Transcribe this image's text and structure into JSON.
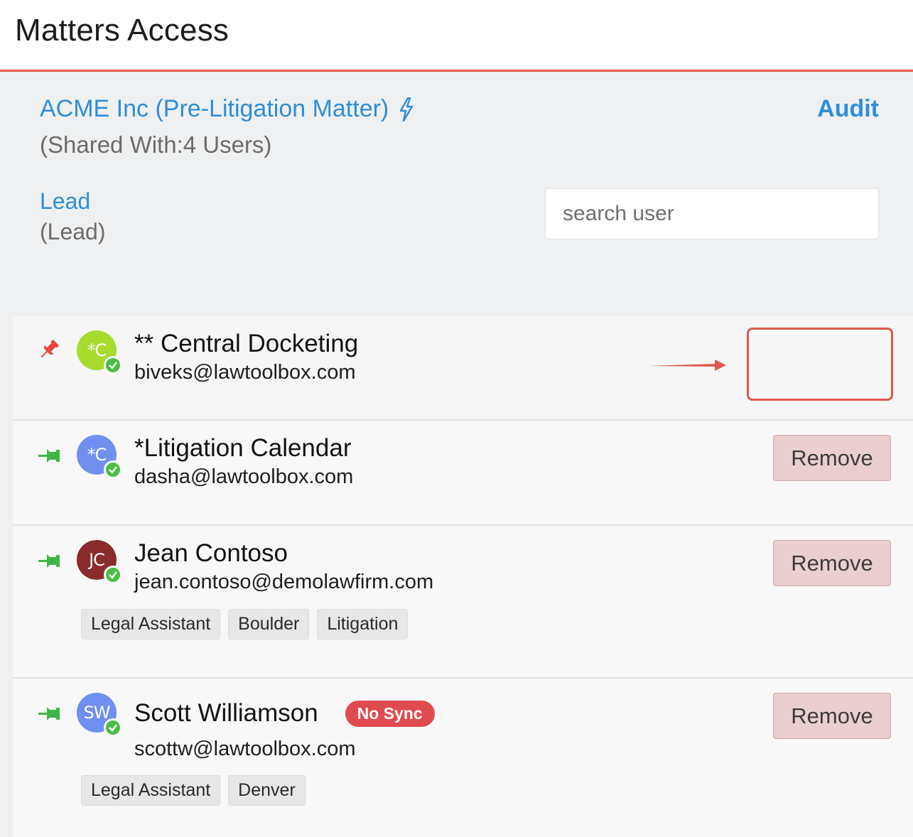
{
  "header": {
    "title": "Matters Access"
  },
  "matter": {
    "title": "ACME Inc (Pre-Litigation Matter)",
    "shared_with": "(Shared With:4 Users)",
    "audit_label": "Audit",
    "lead_label": "Lead",
    "lead_value": "(Lead)"
  },
  "search": {
    "placeholder": "search user",
    "value": ""
  },
  "users": [
    {
      "name": "** Central Docketing",
      "email": "biveks@lawtoolbox.com",
      "initials": "*C",
      "avatar_color": "#a6dc2e",
      "pin_color": "#e8473d",
      "pinned": true,
      "remove_label": "",
      "tags": []
    },
    {
      "name": "*Litigation Calendar",
      "email": "dasha@lawtoolbox.com",
      "initials": "*C",
      "avatar_color": "#6f8ff1",
      "pin_color": "#3fb549",
      "pinned": false,
      "remove_label": "Remove",
      "tags": []
    },
    {
      "name": "Jean Contoso",
      "email": "jean.contoso@demolawfirm.com",
      "initials": "JC",
      "avatar_color": "#8a2c2c",
      "pin_color": "#3fb549",
      "pinned": false,
      "remove_label": "Remove",
      "tags": [
        "Legal Assistant",
        "Boulder",
        "Litigation"
      ]
    },
    {
      "name": "Scott Williamson",
      "email": "scottw@lawtoolbox.com",
      "initials": "SW",
      "avatar_color": "#6f8ff1",
      "pin_color": "#3fb549",
      "pinned": false,
      "remove_label": "Remove",
      "badge": "No Sync",
      "tags": [
        "Legal Assistant",
        "Denver"
      ]
    }
  ],
  "colors": {
    "accent": "#2f8ed9",
    "header_rule": "#e25a4d",
    "remove_bg": "#e9cfcf",
    "badge_bg": "#e04b4f",
    "verified": "#4cbc45"
  },
  "icons": {
    "matter": "bolt-icon",
    "pin": "pushpin-icon",
    "verified": "check-circle-icon"
  }
}
